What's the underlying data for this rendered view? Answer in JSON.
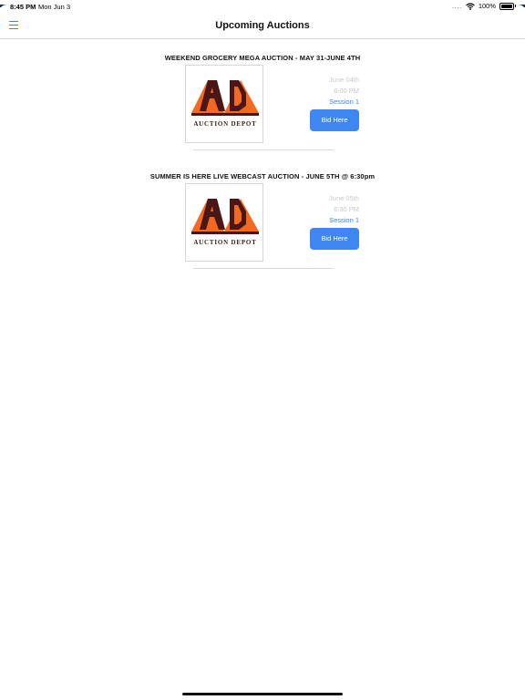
{
  "status": {
    "time": "8:45 PM",
    "date": "Mon Jun 3",
    "signal": "....",
    "battery": "100%"
  },
  "nav": {
    "title": "Upcoming Auctions",
    "menu_icon": "hamburger-menu-icon"
  },
  "auctions": [
    {
      "title": "WEEKEND GROCERY MEGA AUCTION - MAY 31-JUNE 4TH",
      "logo_text": "AUCTION DEPOT",
      "date": "June 04th",
      "time": "6:00 PM",
      "session": "Session 1",
      "button": "Bid Here"
    },
    {
      "title": "SUMMER IS HERE LIVE WEBCAST AUCTION - JUNE 5TH @ 6:30pm",
      "logo_text": "AUCTION DEPOT",
      "date": "June 05th",
      "time": "6:30 PM",
      "session": "Session 1",
      "button": "Bid Here"
    }
  ],
  "colors": {
    "accent": "#3a85ff",
    "button": "#3f87f0",
    "logo_orange": "#f26a21",
    "logo_dark": "#4a1616",
    "muted": "#c9c9c9"
  }
}
